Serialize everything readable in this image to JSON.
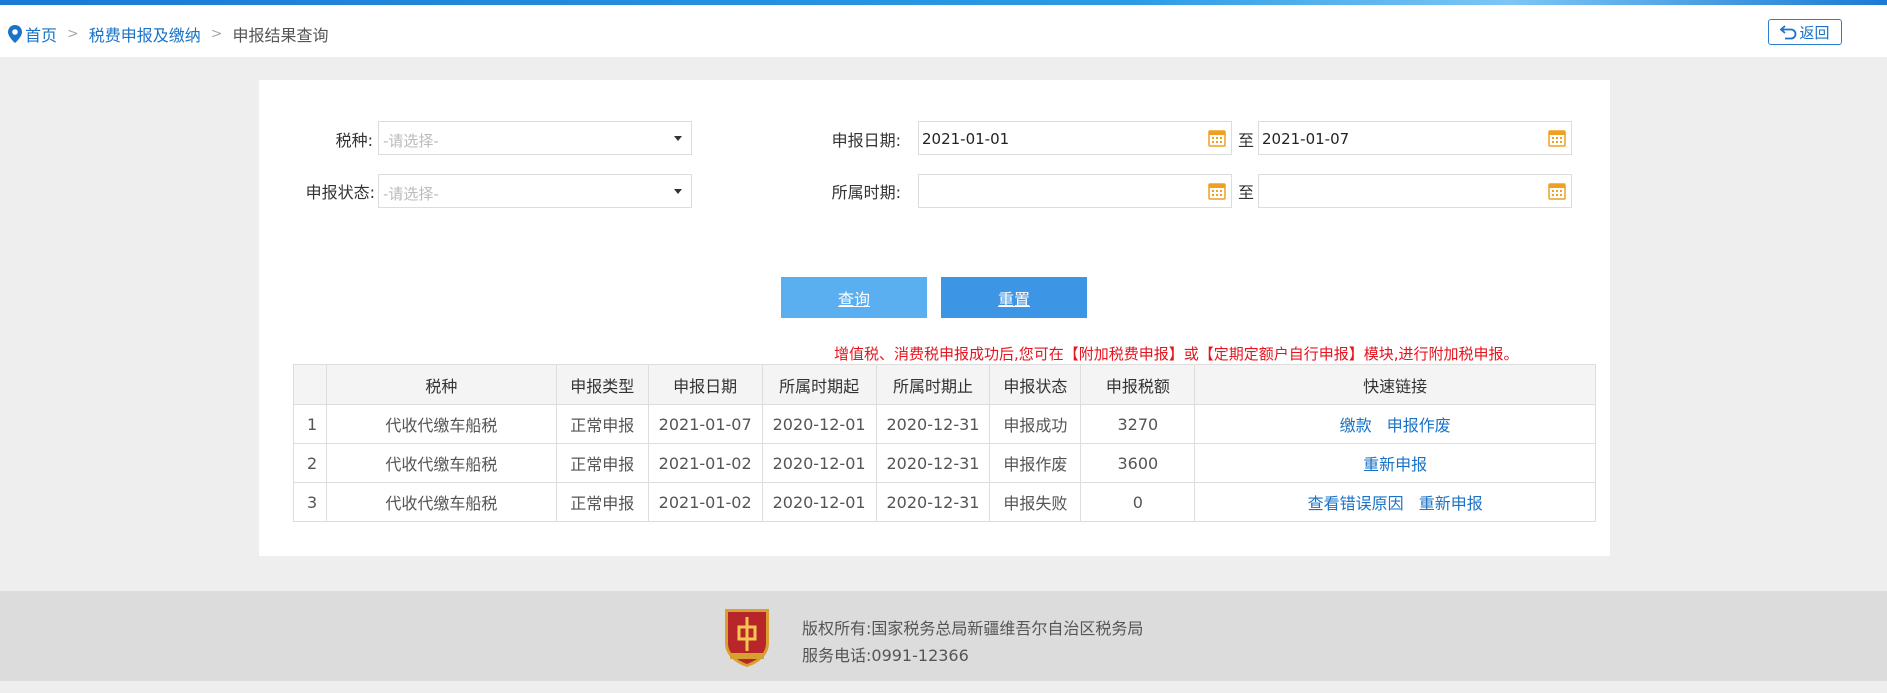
{
  "breadcrumb": {
    "home": "首页",
    "separator": ">",
    "level2": "税费申报及缴纳",
    "current": "申报结果查询"
  },
  "back_label": "返回",
  "form": {
    "tax_type_label": "税种:",
    "tax_type_placeholder": "-请选择-",
    "status_label": "申报状态:",
    "status_placeholder": "-请选择-",
    "declare_date_label": "申报日期:",
    "declare_date_start": "2021-01-01",
    "declare_date_end": "2021-01-07",
    "period_label": "所属时期:",
    "period_start": "",
    "period_end": "",
    "to_label": "至"
  },
  "buttons": {
    "query": "查询",
    "reset": "重置"
  },
  "notice": "增值税、消费税申报成功后,您可在【附加税费申报】或【定期定额户自行申报】模块,进行附加税申报。",
  "table": {
    "headers": [
      "",
      "税种",
      "申报类型",
      "申报日期",
      "所属时期起",
      "所属时期止",
      "申报状态",
      "申报税额",
      "快速链接"
    ],
    "rows": [
      {
        "idx": "1",
        "tax": "代收代缴车船税",
        "type": "正常申报",
        "date": "2021-01-07",
        "start": "2020-12-01",
        "end": "2020-12-31",
        "status": "申报成功",
        "amount": "3270",
        "link1": "缴款",
        "link2": "申报作废"
      },
      {
        "idx": "2",
        "tax": "代收代缴车船税",
        "type": "正常申报",
        "date": "2021-01-02",
        "start": "2020-12-01",
        "end": "2020-12-31",
        "status": "申报作废",
        "amount": "3600",
        "link1": "重新申报",
        "link2": ""
      },
      {
        "idx": "3",
        "tax": "代收代缴车船税",
        "type": "正常申报",
        "date": "2021-01-02",
        "start": "2020-12-01",
        "end": "2020-12-31",
        "status": "申报失败",
        "amount": "0",
        "link1": "查看错误原因",
        "link2": "重新申报"
      }
    ]
  },
  "footer": {
    "copyright": "版权所有:国家税务总局新疆维吾尔自治区税务局",
    "phone": "服务电话:0991-12366"
  },
  "colors": {
    "accent": "#1a73c8",
    "notice": "#e6141e",
    "query_button": "#5aaff0",
    "reset_button": "#3d95e5"
  }
}
